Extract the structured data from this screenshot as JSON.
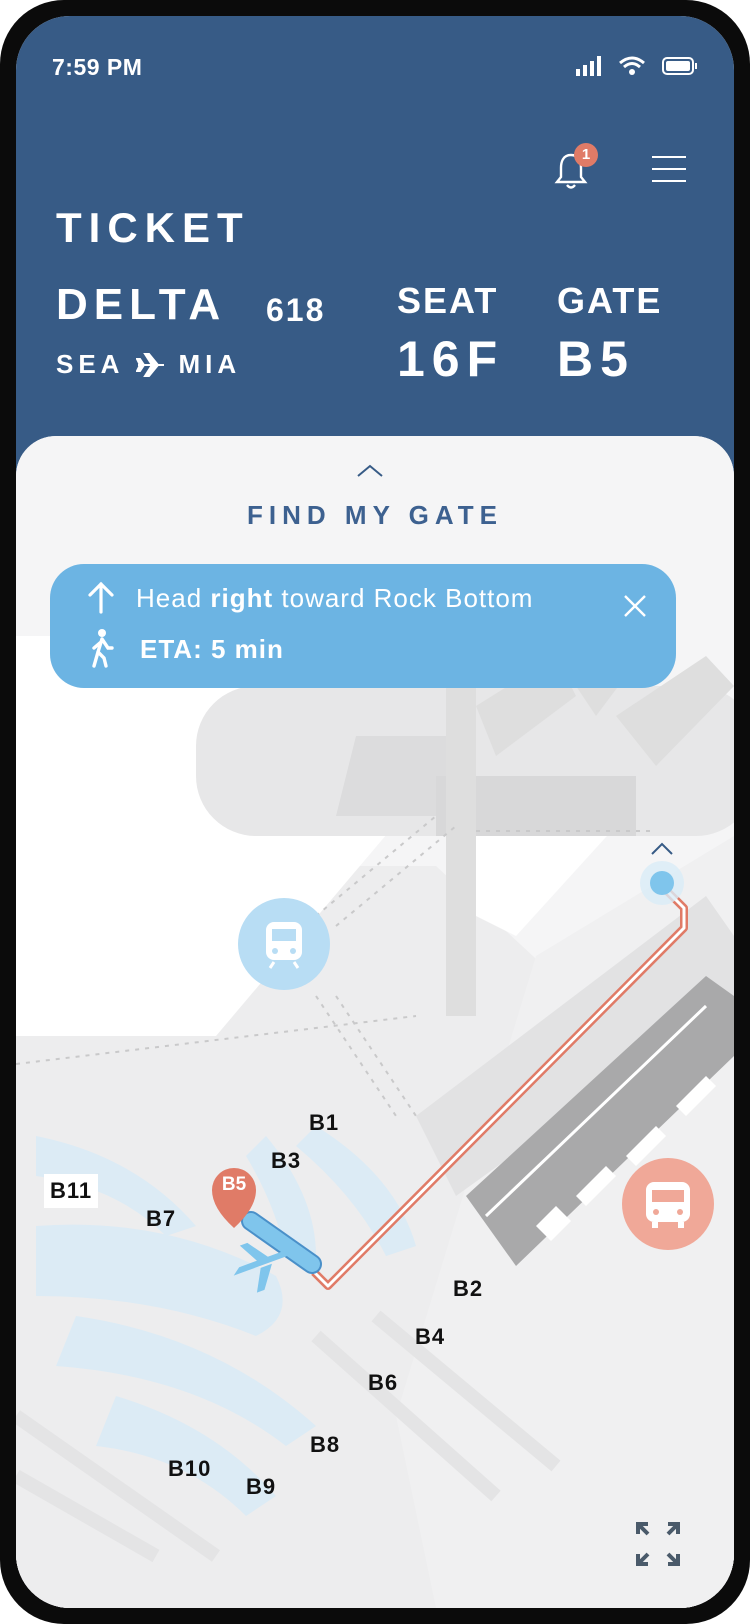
{
  "status_bar": {
    "time": "7:59 PM"
  },
  "header": {
    "notification_count": "1"
  },
  "ticket": {
    "title": "TICKET",
    "airline": "DELTA",
    "flight_number": "618",
    "origin": "SEA",
    "destination": "MIA",
    "seat_label": "SEAT",
    "seat_value": "16F",
    "gate_label": "GATE",
    "gate_value": "B5"
  },
  "sheet": {
    "title": "FIND MY GATE"
  },
  "directions": {
    "text_before": "Head ",
    "text_bold": "right",
    "text_after": " toward Rock Bottom",
    "eta": "ETA: 5 min"
  },
  "map": {
    "destination_marker": "B5",
    "gates": [
      "B1",
      "B3",
      "B11",
      "B7",
      "B2",
      "B4",
      "B6",
      "B8",
      "B10",
      "B9"
    ],
    "icons": [
      "train-icon",
      "bus-icon",
      "plane-icon",
      "location-dot-icon",
      "expand-icon"
    ]
  },
  "colors": {
    "header_bg": "#375b86",
    "banner_bg": "#6cb4e3",
    "route": "#e07b67",
    "accent_blue": "#7fc5ec"
  }
}
